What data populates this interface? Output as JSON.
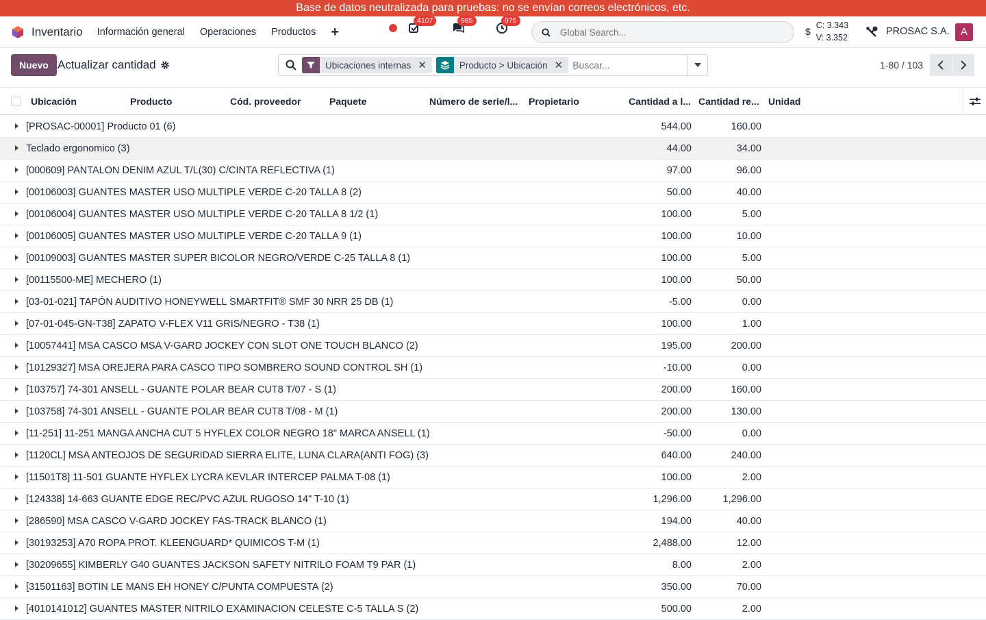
{
  "banner": "Base de datos neutralizada para pruebas: no se envían correos electrónicos, etc.",
  "navbar": {
    "app_name": "Inventario",
    "menus": [
      "Información general",
      "Operaciones",
      "Productos"
    ],
    "badges": {
      "activities": "4107",
      "messages": "985",
      "clock": "975"
    },
    "global_search_placeholder": "Global Search...",
    "currency_symbol": "$",
    "rate_c": "C: 3.343",
    "rate_v": "V: 3.352",
    "company": "PROSAC S.A.",
    "avatar_letter": "A"
  },
  "control": {
    "new_label": "Nuevo",
    "title": "Actualizar cantidad",
    "facets": [
      {
        "label": "Ubicaciones internas",
        "color": "#714b67"
      },
      {
        "label": "Producto > Ubicación",
        "color": "#017e84"
      }
    ],
    "search_placeholder": "Buscar...",
    "pager": "1-80 / 103"
  },
  "table": {
    "columns": [
      "Ubicación",
      "Producto",
      "Cód. proveedor",
      "Paquete",
      "Número de serie/l...",
      "Propietario",
      "Cantidad a l...",
      "Cantidad re...",
      "Unidad"
    ],
    "rows": [
      {
        "name": "[PROSAC-00001] Producto 01 (6)",
        "qty": "544.00",
        "reserved": "160.00"
      },
      {
        "name": "Teclado ergonomico (3)",
        "qty": "44.00",
        "reserved": "34.00"
      },
      {
        "name": "[000609] PANTALON DENIM AZUL T/L(30) C/CINTA REFLECTIVA (1)",
        "qty": "97.00",
        "reserved": "96.00"
      },
      {
        "name": "[00106003] GUANTES MASTER USO MULTIPLE VERDE C-20 TALLA 8 (2)",
        "qty": "50.00",
        "reserved": "40.00"
      },
      {
        "name": "[00106004] GUANTES MASTER USO MULTIPLE VERDE C-20 TALLA 8 1/2 (1)",
        "qty": "100.00",
        "reserved": "5.00"
      },
      {
        "name": "[00106005] GUANTES MASTER USO MULTIPLE VERDE C-20 TALLA 9 (1)",
        "qty": "100.00",
        "reserved": "10.00"
      },
      {
        "name": "[00109003] GUANTES MASTER SUPER BICOLOR NEGRO/VERDE C-25 TALLA 8 (1)",
        "qty": "100.00",
        "reserved": "5.00"
      },
      {
        "name": "[00115500-ME] MECHERO (1)",
        "qty": "100.00",
        "reserved": "50.00"
      },
      {
        "name": "[03-01-021] TAPÓN AUDITIVO HONEYWELL SMARTFIT® SMF 30 NRR 25 DB (1)",
        "qty": "-5.00",
        "reserved": "0.00"
      },
      {
        "name": "[07-01-045-GN-T38] ZAPATO V-FLEX V11 GRIS/NEGRO - T38 (1)",
        "qty": "100.00",
        "reserved": "1.00"
      },
      {
        "name": "[10057441] MSA CASCO MSA V-GARD JOCKEY CON SLOT ONE TOUCH BLANCO (2)",
        "qty": "195.00",
        "reserved": "200.00"
      },
      {
        "name": "[10129327] MSA OREJERA PARA CASCO TIPO SOMBRERO SOUND CONTROL SH (1)",
        "qty": "-10.00",
        "reserved": "0.00"
      },
      {
        "name": "[103757] 74-301 ANSELL - GUANTE POLAR BEAR CUT8 T/07 - S (1)",
        "qty": "200.00",
        "reserved": "160.00"
      },
      {
        "name": "[103758] 74-301 ANSELL - GUANTE POLAR BEAR CUT8 T/08 - M (1)",
        "qty": "200.00",
        "reserved": "130.00"
      },
      {
        "name": "[11-251] 11-251 MANGA ANCHA CUT 5 HYFLEX COLOR NEGRO 18\" MARCA ANSELL (1)",
        "qty": "-50.00",
        "reserved": "0.00"
      },
      {
        "name": "[1120CL] MSA ANTEOJOS DE SEGURIDAD SIERRA ELITE, LUNA CLARA(ANTI FOG) (3)",
        "qty": "640.00",
        "reserved": "240.00"
      },
      {
        "name": "[11501T8] 11-501 GUANTE HYFLEX LYCRA KEVLAR INTERCEP PALMA T-08 (1)",
        "qty": "100.00",
        "reserved": "2.00"
      },
      {
        "name": "[124338] 14-663 GUANTE EDGE REC/PVC AZUL RUGOSO 14\" T-10 (1)",
        "qty": "1,296.00",
        "reserved": "1,296.00"
      },
      {
        "name": "[286590] MSA CASCO V-GARD JOCKEY FAS-TRACK BLANCO (1)",
        "qty": "194.00",
        "reserved": "40.00"
      },
      {
        "name": "[30193253] A70 ROPA PROT. KLEENGUARD* QUIMICOS T-M (1)",
        "qty": "2,488.00",
        "reserved": "12.00"
      },
      {
        "name": "[30209655] KIMBERLY G40 GUANTES JACKSON SAFETY NITRILO FOAM T9 PAR (1)",
        "qty": "8.00",
        "reserved": "2.00"
      },
      {
        "name": "[31501163] BOTIN LE MANS EH HONEY C/PUNTA COMPUESTA (2)",
        "qty": "350.00",
        "reserved": "70.00"
      },
      {
        "name": "[4010141012] GUANTES MASTER NITRILO EXAMINACION CELESTE C-5 TALLA S (2)",
        "qty": "500.00",
        "reserved": "2.00"
      }
    ]
  }
}
